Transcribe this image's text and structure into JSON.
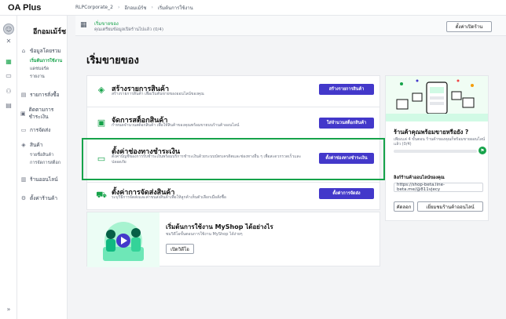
{
  "topbar": {
    "logo": "OA Plus",
    "crumbs": [
      "RLPCorporate_2",
      "อีกอมเม้ร์ช",
      "เริ่มต้นการใช้งาน"
    ]
  },
  "sidebar": {
    "shop_name": "อีกอมเม้ร์ช",
    "items": [
      {
        "icon": "home-icon",
        "label": "ข้อมูลโดยรวม"
      },
      {
        "icon": "receipt-icon",
        "label": "รายการสั่งซื้อ"
      },
      {
        "icon": "wallet-icon",
        "label": "ติดตามการชำระเงิน"
      },
      {
        "icon": "truck-icon",
        "label": "การจัดส่ง"
      },
      {
        "icon": "tag-icon",
        "label": "สินค้า"
      },
      {
        "icon": "store-icon",
        "label": "ร้านออนไลน์"
      },
      {
        "icon": "gear-icon",
        "label": "ตั้งค่าร้านค้า"
      }
    ],
    "overview_subs": [
      "เริ่มต้นการใช้งาน",
      "แดชบอร์ด",
      "รายงาน"
    ],
    "product_subs": [
      "รายชื่อสินค้า",
      "การจัดการสต็อก"
    ]
  },
  "header": {
    "title": "เริ่มขายของ",
    "subtitle": "คุณเตรียมข้อมูลเปิดร้านไปแล้ว (0/4)",
    "open_store_button": "ตั้งค่าเปิดร้าน"
  },
  "main": {
    "page_title": "เริ่มขายของ",
    "tasks": [
      {
        "title": "สร้างรายการสินค้า",
        "desc": "สร้างรายการสินค้า เพื่อเริ่มต้นขายของออนไลน์ของคุณ",
        "button": "สร้างรายการสินค้า"
      },
      {
        "title": "จัดการสต็อกสินค้า",
        "desc": "กำหนดจำนวนสต็อกสินค้า เพื่อให้สินค้าของคุณพร้อมขายบนร้านค้าออนไลน์",
        "button": "ใส่จำนวนสต็อกสินค้า"
      },
      {
        "title": "ตั้งค่าช่องทางชำระเงิน",
        "desc": "ตั้งค่าบัญชีของการรับชำระเงินพร้อมบริการชำระเงินด้วยระบบบัตรเครดิตและช่องทางอื่น ๆ เพื่อสะดวกรวดเร็วและปลอดภัย",
        "button": "ตั้งค่าช่องทางชำระเงิน"
      },
      {
        "title": "ตั้งค่าการจัดส่งสินค้า",
        "desc": "ระบุวิธีการจัดส่งและค่าขนส่งสินค้าเพื่อให้ลูกค้าเห็นตัวเลือกเมื่อสั่งซื้อ",
        "button": "ตั้งค่าการจัดส่ง"
      }
    ],
    "promo": {
      "title": "เริ่มต้นการใช้งาน MyShop ได้อย่างไร",
      "desc": "ชมวิดีโอขั้นตอนการใช้งาน MyShop ได้ง่ายๆ",
      "button": "เปิดวิดีโอ"
    }
  },
  "right_panel": {
    "title": "ร้านค้าคุณพร้อมขายหรือยัง ?",
    "desc": "เพียงแค่ 4 ขั้นตอน ร้านค้าของคุณก็พร้อมขายออนไลน์แล้ว (0/4)",
    "progress": 0,
    "link_label": "ลิงก์ร้านค้าออนไลน์ของคุณ",
    "link_value": "https://shop-beta.line-beta.me/@811vjecy",
    "copy_button": "คัดลอก",
    "view_button": "เยี่ยมชมร้านค้าออนไลน์"
  }
}
